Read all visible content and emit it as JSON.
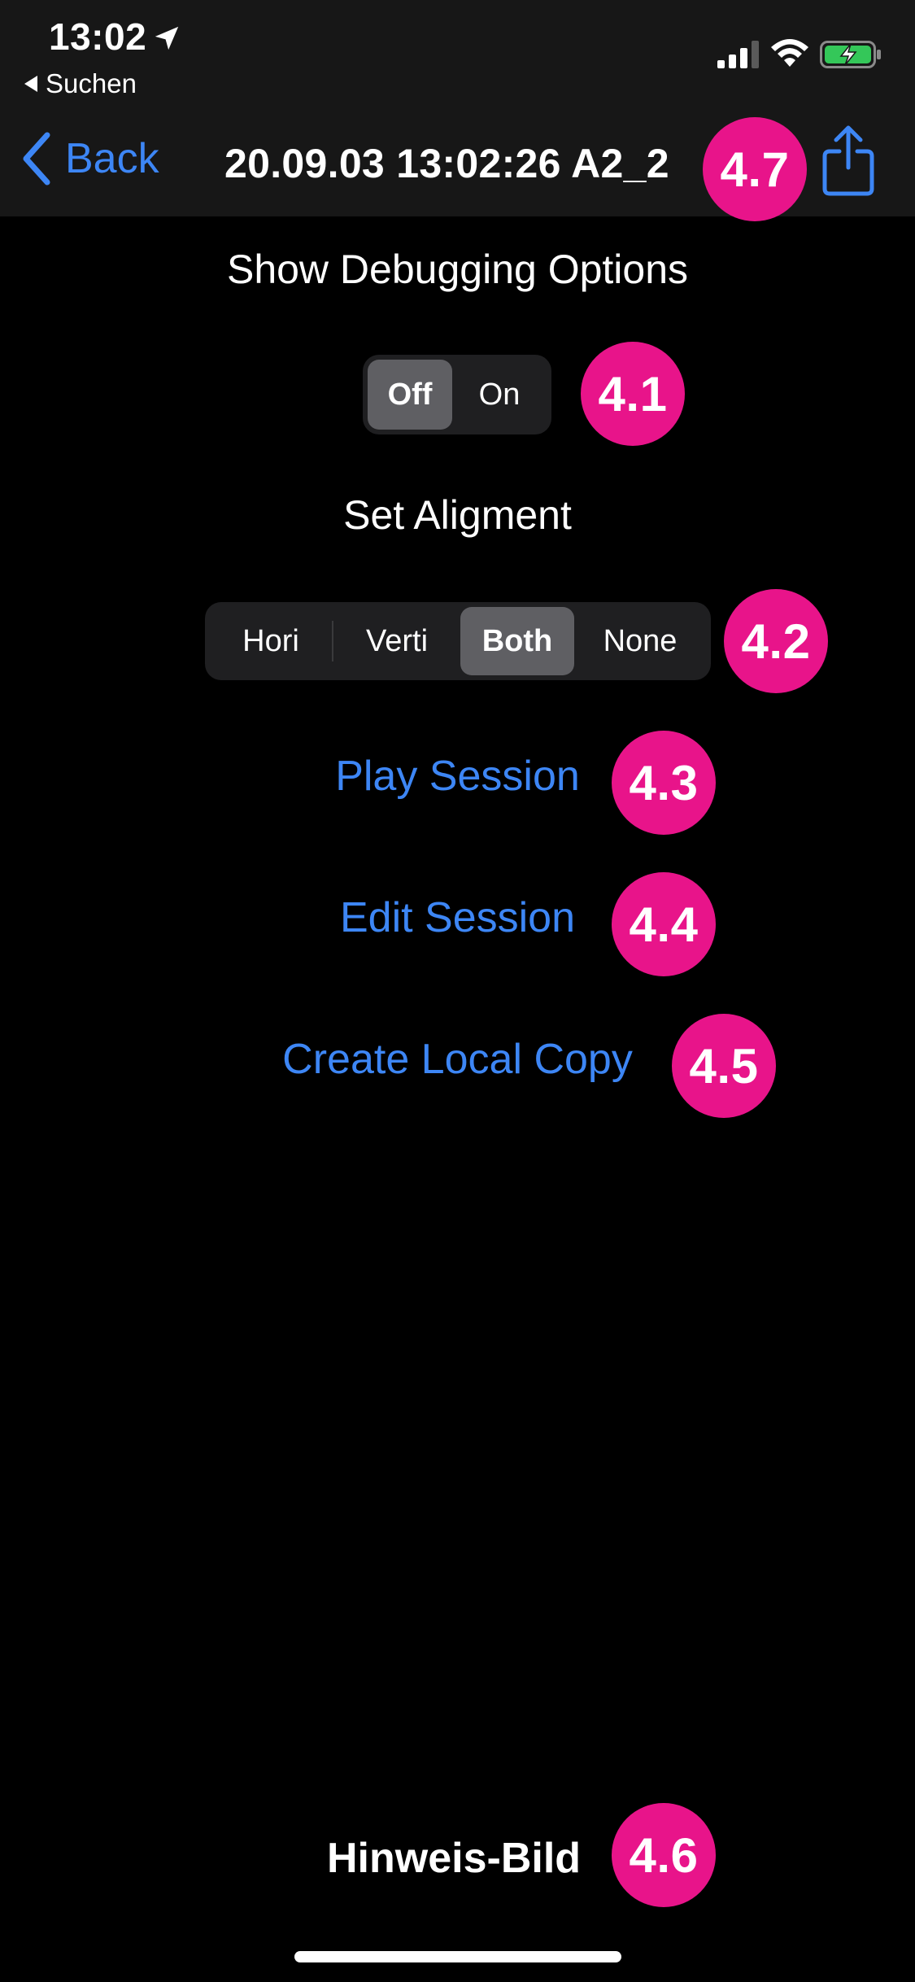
{
  "status_bar": {
    "time": "13:02",
    "back_app_label": "Suchen",
    "icons": [
      "location-arrow-icon",
      "cellular-signal-icon",
      "wifi-icon",
      "battery-charging-icon"
    ],
    "battery_color": "#34c759"
  },
  "nav": {
    "back_label": "Back",
    "title": "20.09.03 13:02:26 A2_2",
    "share_icon": "share-icon",
    "accent_color": "#3d86f5"
  },
  "debug": {
    "heading": "Show Debugging Options",
    "options": [
      "Off",
      "On"
    ],
    "selected": "Off"
  },
  "alignment": {
    "heading": "Set Aligment",
    "options": [
      "Hori",
      "Verti",
      "Both",
      "None"
    ],
    "selected": "Both"
  },
  "actions": {
    "play": "Play Session",
    "edit": "Edit Session",
    "copy": "Create Local Copy"
  },
  "hint_label": "Hinweis-Bild",
  "badges": {
    "b41": "4.1",
    "b42": "4.2",
    "b43": "4.3",
    "b44": "4.4",
    "b45": "4.5",
    "b46": "4.6",
    "b47": "4.7",
    "color": "#e8148a"
  }
}
